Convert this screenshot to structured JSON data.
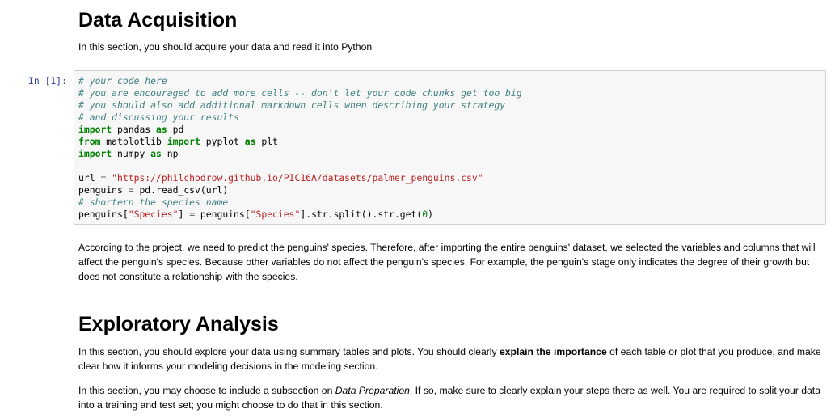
{
  "section1": {
    "heading": "Data Acquisition",
    "intro": "In this section, you should acquire your data and read it into Python"
  },
  "code_cell": {
    "prompt": "In [1]:",
    "lines": {
      "l1": "# your code here",
      "l2": "# you are encouraged to add more cells -- don't let your code chunks get too big",
      "l3": "# you should also add additional markdown cells when describing your strategy",
      "l4": "# and discussing your results",
      "l5_kw": "import",
      "l5_mod": " pandas ",
      "l5_as": "as",
      "l5_alias": " pd",
      "l6_from": "from",
      "l6_mod": " matplotlib ",
      "l6_import": "import",
      "l6_name": " pyplot ",
      "l6_as": "as",
      "l6_alias": " plt",
      "l7_kw": "import",
      "l7_mod": " numpy ",
      "l7_as": "as",
      "l7_alias": " np",
      "l9_var": "url ",
      "l9_op": "=",
      "l9_str": " \"https://philchodrow.github.io/PIC16A/datasets/palmer_penguins.csv\"",
      "l10_var": "penguins ",
      "l10_op": "=",
      "l10_rest": " pd.read_csv(url)",
      "l11": "# shortern the species name",
      "l12_a": "penguins[",
      "l12_s1": "\"Species\"",
      "l12_b": "] ",
      "l12_op": "=",
      "l12_c": " penguins[",
      "l12_s2": "\"Species\"",
      "l12_d": "].str.split().str.get(",
      "l12_num": "0",
      "l12_e": ")"
    }
  },
  "explanation": "According to the project, we need to predict the penguins' species. Therefore, after importing the entire penguins' dataset, we selected the variables and columns that will affect the penguin's species. Because other variables do not affect the penguin's species. For example, the penguin's stage only indicates the degree of their growth but does not constitute a relationship with the species.",
  "section2": {
    "heading": "Exploratory Analysis",
    "p1_a": "In this section, you should explore your data using summary tables and plots. You should clearly ",
    "p1_bold": "explain the importance",
    "p1_b": " of each table or plot that you produce, and make clear how it informs your modeling decisions in the modeling section.",
    "p2_a": "In this section, you may choose to include a subsection on ",
    "p2_italic": "Data Preparation",
    "p2_b": ". If so, make sure to clearly explain your steps there as well. You are required to split your data into a training and test set; you might choose to do that in this section."
  }
}
